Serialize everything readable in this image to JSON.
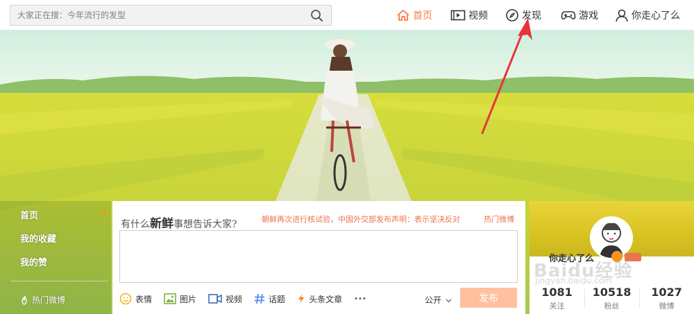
{
  "search": {
    "placeholder": "大家正在搜：今年流行的发型"
  },
  "nav": {
    "home": "首页",
    "video": "视频",
    "discover": "发现",
    "game": "游戏",
    "user": "你走心了么"
  },
  "colors": {
    "accent": "#fa7d3c",
    "send_button": "#ffc09f",
    "hot_text": "#eb7350"
  },
  "leftnav": {
    "items": [
      "首页",
      "我的收藏",
      "我的赞"
    ],
    "hot": "热门微博"
  },
  "compose": {
    "prompt_parts": [
      "有什么",
      "新鲜",
      "事想告诉大家?"
    ],
    "hot_news": "朝鲜再次进行核试验，中国外交部发布声明：表示坚决反对",
    "hot_link": "热门微博",
    "tools": [
      "表情",
      "图片",
      "视频",
      "话题",
      "头条文章"
    ],
    "more": "•••",
    "visibility": "公开",
    "send": "发布"
  },
  "profile": {
    "name": "你走心了么",
    "stats": [
      {
        "value": "1081",
        "label": "关注"
      },
      {
        "value": "10518",
        "label": "粉丝"
      },
      {
        "value": "1027",
        "label": "微博"
      }
    ]
  },
  "watermark": {
    "brand": "Baidu经验",
    "url": "jingyan.baidu.com"
  }
}
